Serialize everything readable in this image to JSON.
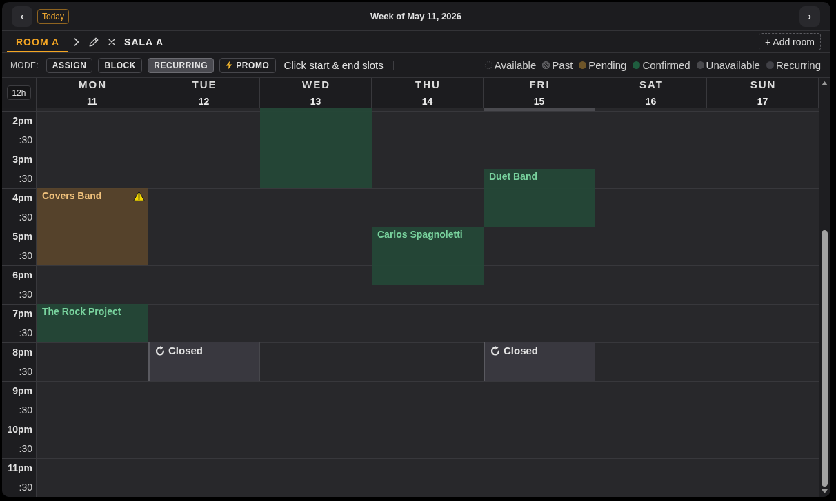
{
  "header": {
    "prev": "‹",
    "today": "Today",
    "title": "Week of May 11, 2026",
    "next": "›"
  },
  "rooms": {
    "tabs": [
      {
        "label": "ROOM A",
        "selected": true
      },
      {
        "label": "SALA A",
        "selected": false
      }
    ],
    "add_room": "+ Add room"
  },
  "toolbar": {
    "mode_label": "MODE:",
    "modes": [
      {
        "label": "ASSIGN",
        "kind": "mode",
        "selected": false
      },
      {
        "label": "BLOCK",
        "kind": "mode",
        "selected": false
      },
      {
        "label": "RECURRING",
        "kind": "mode",
        "selected": true
      },
      {
        "label": "PROMO",
        "kind": "promo",
        "selected": false
      }
    ],
    "hint": "Click start & end slots",
    "legend": [
      {
        "label": "Available",
        "kind": "available",
        "color": "#4a4a4e"
      },
      {
        "label": "Past",
        "kind": "past",
        "color": "#6a6a6e"
      },
      {
        "label": "Pending",
        "kind": "pending",
        "color": "#6e5529"
      },
      {
        "label": "Confirmed",
        "kind": "confirmed",
        "color": "#1f5d3f"
      },
      {
        "label": "Unavailable",
        "kind": "unavailable",
        "color": "#48484c"
      },
      {
        "label": "Recurring",
        "kind": "recurring",
        "color": "#404046"
      }
    ]
  },
  "calendar": {
    "format_toggle": "12h",
    "times": [
      {
        "hour": "2pm",
        "half": ":30"
      },
      {
        "hour": "3pm",
        "half": ":30"
      },
      {
        "hour": "4pm",
        "half": ":30"
      },
      {
        "hour": "5pm",
        "half": ":30"
      },
      {
        "hour": "6pm",
        "half": ":30"
      },
      {
        "hour": "7pm",
        "half": ":30"
      },
      {
        "hour": "8pm",
        "half": ":30"
      },
      {
        "hour": "9pm",
        "half": ":30"
      },
      {
        "hour": "10pm",
        "half": ":30"
      },
      {
        "hour": "11pm",
        "half": ":30"
      }
    ],
    "days": [
      {
        "name": "MON",
        "date": "11",
        "partial_top_slot": {
          "kind": "available"
        },
        "slots": [
          {
            "kind": "available"
          },
          {
            "kind": "available"
          },
          {
            "kind": "available"
          },
          {
            "kind": "available"
          },
          {
            "kind": "pending",
            "title": "Covers Band",
            "warning": true
          },
          {
            "kind": "pending"
          },
          {
            "kind": "pending"
          },
          {
            "kind": "pending"
          },
          {
            "kind": "available"
          },
          {
            "kind": "available"
          },
          {
            "kind": "confirmed",
            "title": "The Rock Project",
            "warning": false
          },
          {
            "kind": "confirmed"
          },
          {
            "kind": "available"
          },
          {
            "kind": "available"
          },
          {
            "kind": "available"
          },
          {
            "kind": "available"
          },
          {
            "kind": "available"
          },
          {
            "kind": "available"
          },
          {
            "kind": "available"
          },
          {
            "kind": "available"
          }
        ]
      },
      {
        "name": "TUE",
        "date": "12",
        "partial_top_slot": {
          "kind": "available"
        },
        "slots": [
          {
            "kind": "available"
          },
          {
            "kind": "available"
          },
          {
            "kind": "available"
          },
          {
            "kind": "available"
          },
          {
            "kind": "available"
          },
          {
            "kind": "available"
          },
          {
            "kind": "available"
          },
          {
            "kind": "available"
          },
          {
            "kind": "available"
          },
          {
            "kind": "available"
          },
          {
            "kind": "available"
          },
          {
            "kind": "available"
          },
          {
            "kind": "recurring",
            "title": "Closed",
            "warning": false
          },
          {
            "kind": "recurring"
          },
          {
            "kind": "available"
          },
          {
            "kind": "available"
          },
          {
            "kind": "available"
          },
          {
            "kind": "available"
          },
          {
            "kind": "available"
          },
          {
            "kind": "available"
          }
        ]
      },
      {
        "name": "WED",
        "date": "13",
        "partial_top_slot": {
          "kind": "confirmed"
        },
        "slots": [
          {
            "kind": "confirmed"
          },
          {
            "kind": "confirmed"
          },
          {
            "kind": "confirmed"
          },
          {
            "kind": "confirmed"
          },
          {
            "kind": "available"
          },
          {
            "kind": "available"
          },
          {
            "kind": "available"
          },
          {
            "kind": "available"
          },
          {
            "kind": "available"
          },
          {
            "kind": "available"
          },
          {
            "kind": "available"
          },
          {
            "kind": "available"
          },
          {
            "kind": "available"
          },
          {
            "kind": "available"
          },
          {
            "kind": "available"
          },
          {
            "kind": "available"
          },
          {
            "kind": "available"
          },
          {
            "kind": "available"
          },
          {
            "kind": "available"
          },
          {
            "kind": "available"
          }
        ]
      },
      {
        "name": "THU",
        "date": "14",
        "partial_top_slot": {
          "kind": "available"
        },
        "slots": [
          {
            "kind": "available"
          },
          {
            "kind": "available"
          },
          {
            "kind": "available"
          },
          {
            "kind": "available"
          },
          {
            "kind": "available"
          },
          {
            "kind": "available"
          },
          {
            "kind": "confirmed",
            "title": "Carlos Spagnoletti",
            "warning": false
          },
          {
            "kind": "confirmed"
          },
          {
            "kind": "confirmed"
          },
          {
            "kind": "available"
          },
          {
            "kind": "available"
          },
          {
            "kind": "available"
          },
          {
            "kind": "available"
          },
          {
            "kind": "available"
          },
          {
            "kind": "available"
          },
          {
            "kind": "available"
          },
          {
            "kind": "available"
          },
          {
            "kind": "available"
          },
          {
            "kind": "available"
          },
          {
            "kind": "available"
          }
        ]
      },
      {
        "name": "FRI",
        "date": "15",
        "partial_top_slot": {
          "kind": "unavailable"
        },
        "slots": [
          {
            "kind": "available"
          },
          {
            "kind": "available"
          },
          {
            "kind": "available"
          },
          {
            "kind": "confirmed",
            "title": "Duet Band",
            "warning": false
          },
          {
            "kind": "confirmed"
          },
          {
            "kind": "confirmed"
          },
          {
            "kind": "available"
          },
          {
            "kind": "available"
          },
          {
            "kind": "available"
          },
          {
            "kind": "available"
          },
          {
            "kind": "available"
          },
          {
            "kind": "available"
          },
          {
            "kind": "recurring",
            "title": "Closed",
            "warning": false
          },
          {
            "kind": "recurring"
          },
          {
            "kind": "available"
          },
          {
            "kind": "available"
          },
          {
            "kind": "available"
          },
          {
            "kind": "available"
          },
          {
            "kind": "available"
          },
          {
            "kind": "available"
          }
        ]
      },
      {
        "name": "SAT",
        "date": "16",
        "partial_top_slot": {
          "kind": "available"
        },
        "slots": [
          {
            "kind": "available"
          },
          {
            "kind": "available"
          },
          {
            "kind": "available"
          },
          {
            "kind": "available"
          },
          {
            "kind": "available"
          },
          {
            "kind": "available"
          },
          {
            "kind": "available"
          },
          {
            "kind": "available"
          },
          {
            "kind": "available"
          },
          {
            "kind": "available"
          },
          {
            "kind": "available"
          },
          {
            "kind": "available"
          },
          {
            "kind": "available"
          },
          {
            "kind": "available"
          },
          {
            "kind": "available"
          },
          {
            "kind": "available"
          },
          {
            "kind": "available"
          },
          {
            "kind": "available"
          },
          {
            "kind": "available"
          },
          {
            "kind": "available"
          }
        ]
      },
      {
        "name": "SUN",
        "date": "17",
        "partial_top_slot": {
          "kind": "available"
        },
        "slots": [
          {
            "kind": "available"
          },
          {
            "kind": "available"
          },
          {
            "kind": "available"
          },
          {
            "kind": "available"
          },
          {
            "kind": "available"
          },
          {
            "kind": "available"
          },
          {
            "kind": "available"
          },
          {
            "kind": "available"
          },
          {
            "kind": "available"
          },
          {
            "kind": "available"
          },
          {
            "kind": "available"
          },
          {
            "kind": "available"
          },
          {
            "kind": "available"
          },
          {
            "kind": "available"
          },
          {
            "kind": "available"
          },
          {
            "kind": "available"
          },
          {
            "kind": "available"
          },
          {
            "kind": "available"
          },
          {
            "kind": "available"
          },
          {
            "kind": "available"
          }
        ]
      }
    ]
  }
}
